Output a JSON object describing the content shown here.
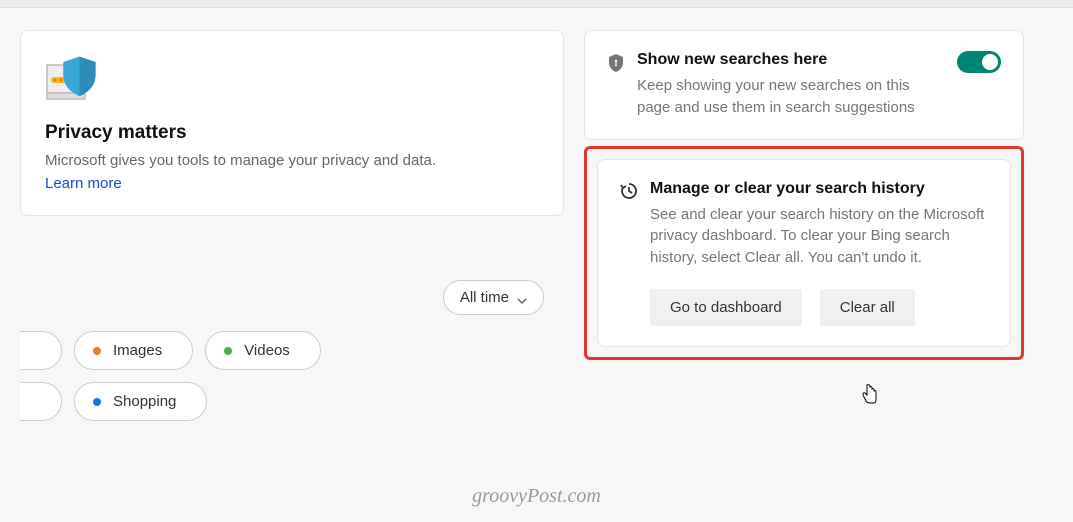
{
  "privacy_card": {
    "title": "Privacy matters",
    "description": "Microsoft gives you tools to manage your privacy and data.",
    "learn_more": "Learn more"
  },
  "time_filter": {
    "selected": "All time"
  },
  "chips": {
    "images": "Images",
    "videos": "Videos",
    "shopping": "Shopping"
  },
  "show_searches_card": {
    "title": "Show new searches here",
    "description": "Keep showing your new searches on this page and use them in search suggestions"
  },
  "manage_card": {
    "title": "Manage or clear your search history",
    "description": "See and clear your search history on the Microsoft privacy dashboard. To clear your Bing search history, select Clear all. You can't undo it.",
    "dashboard_button": "Go to dashboard",
    "clear_button": "Clear all"
  },
  "watermark": "groovyPost.com"
}
